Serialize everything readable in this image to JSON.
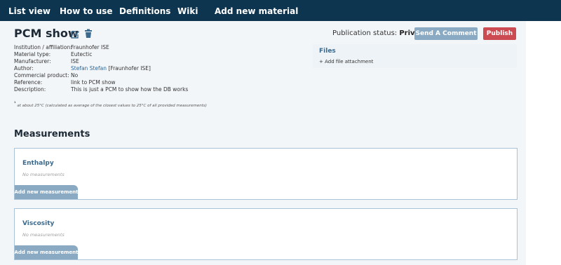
{
  "nav": {
    "items": [
      "List view",
      "How to use",
      "Definitions",
      "Wiki",
      "Add new material"
    ]
  },
  "material": {
    "title": "PCM show",
    "edit_icon": "edit-icon",
    "delete_icon": "trash-icon",
    "publication_label": "Publication status:",
    "publication_value": "Private",
    "send_comment_label": "Send A Comment",
    "publish_label": "Publish",
    "properties": [
      {
        "key": "Institution / affiliation:",
        "value": "Fraunhofer ISE"
      },
      {
        "key": "Material type:",
        "value": "Eutectic"
      },
      {
        "key": "Manufacturer:",
        "value": "ISE"
      },
      {
        "key": "Author:",
        "value_link": "Stefan Stefan",
        "value": "[Fraunhofer ISE]"
      },
      {
        "key": "Commercial product:",
        "value": "No"
      },
      {
        "key": "Reference:",
        "value": "link to PCM show"
      },
      {
        "key": "Description:",
        "value": "This is just a PCM to show how the DB works"
      }
    ],
    "footnote_mark": "¹",
    "footnote": "at about 25°C (calculated as average of the closest values to 25°C of all provided measurements)"
  },
  "files": {
    "title": "Files",
    "add_label": "+ Add file attachment"
  },
  "measurements": {
    "title": "Measurements",
    "cards": [
      {
        "title": "Enthalpy",
        "empty_text": "No measurements",
        "add_label": "Add new measurement"
      },
      {
        "title": "Viscosity",
        "empty_text": "No measurements",
        "add_label": "Add new measurement"
      }
    ]
  },
  "colors": {
    "navbar": "#0e3550",
    "comment_button": "#8aaac3",
    "publish_button": "#cc4b52",
    "accent_text": "#3b6a8d"
  }
}
